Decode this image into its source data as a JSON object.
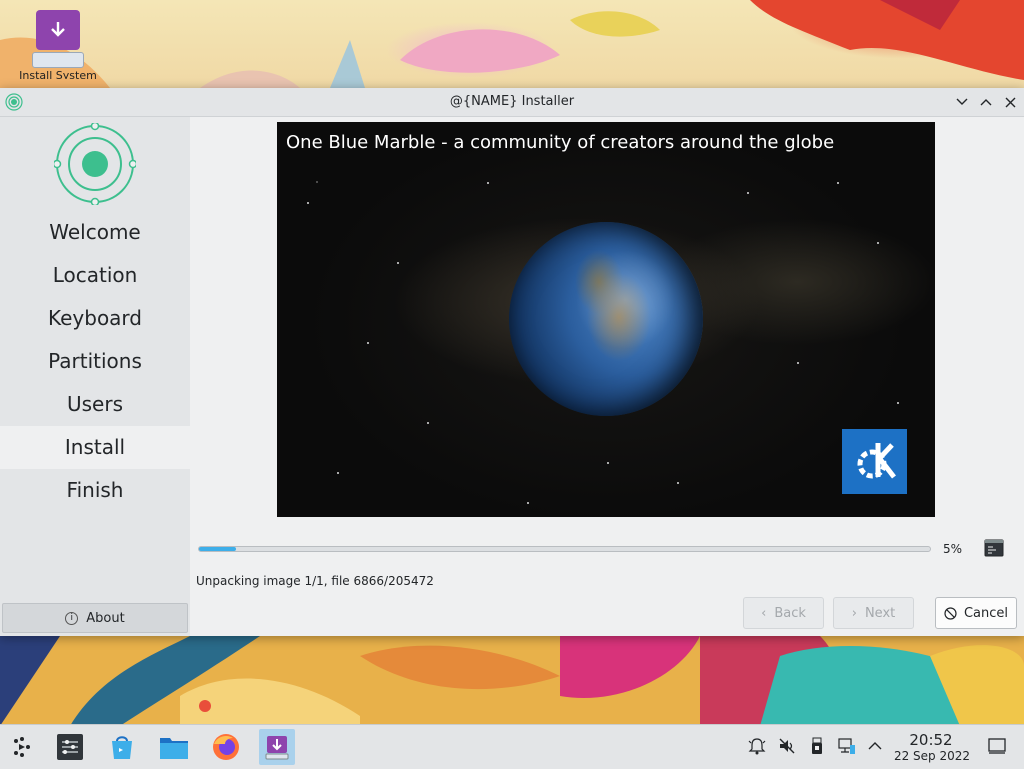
{
  "desktop": {
    "icon_label": "Install System"
  },
  "window": {
    "title": "@{NAME} Installer",
    "controls": [
      "minimize",
      "maximize",
      "close"
    ]
  },
  "sidebar": {
    "steps": [
      {
        "label": "Welcome"
      },
      {
        "label": "Location"
      },
      {
        "label": "Keyboard"
      },
      {
        "label": "Partitions"
      },
      {
        "label": "Users"
      },
      {
        "label": "Install",
        "active": true
      },
      {
        "label": "Finish"
      }
    ],
    "about_label": "About"
  },
  "slideshow": {
    "caption": "One Blue Marble - a community of creators around the globe"
  },
  "progress": {
    "percent": 5,
    "label": "5%",
    "status": "Unpacking image 1/1, file 6866/205472"
  },
  "buttons": {
    "back": "Back",
    "next": "Next",
    "cancel": "Cancel"
  },
  "taskbar": {
    "apps": [
      {
        "name": "application-launcher-icon"
      },
      {
        "name": "system-settings-icon"
      },
      {
        "name": "discover-icon"
      },
      {
        "name": "dolphin-icon"
      },
      {
        "name": "firefox-icon"
      },
      {
        "name": "installer-icon",
        "active": true
      }
    ],
    "tray": [
      "notifications-icon",
      "volume-muted-icon",
      "usb-device-icon",
      "network-icon",
      "show-hidden-icon"
    ],
    "clock": {
      "time": "20:52",
      "date": "22 Sep 2022"
    }
  },
  "colors": {
    "accent": "#3daee9",
    "sidebar_bg": "#e3e5e7",
    "window_bg": "#eff0f1",
    "kde_blue": "#1d71c5",
    "installer_purple": "#8e44ad",
    "logo_green": "#3dbf8e"
  }
}
